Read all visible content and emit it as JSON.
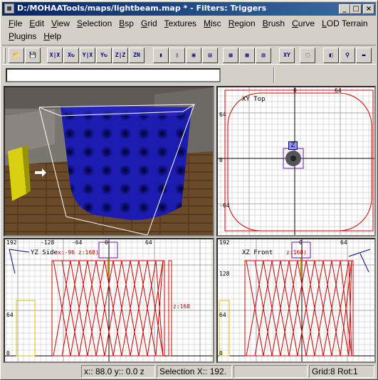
{
  "window": {
    "title": "D:/MOHAATools/maps/lightbeam.map * - Filters: Triggers",
    "minimize": "_",
    "maximize": "□",
    "close": "×"
  },
  "menu": {
    "row1": [
      "File",
      "Edit",
      "View",
      "Selection",
      "Bsp",
      "Grid",
      "Textures",
      "Misc",
      "Region",
      "Brush",
      "Curve",
      "LOD Terrain"
    ],
    "row2": [
      "Plugins",
      "Help"
    ]
  },
  "toolbar": {
    "buttons": [
      {
        "name": "open-icon",
        "glyph": "📂"
      },
      {
        "name": "save-icon",
        "glyph": "💾"
      },
      {
        "name": "flip-x-icon",
        "glyph": "X|X"
      },
      {
        "name": "rotate-x-icon",
        "glyph": "X↻"
      },
      {
        "name": "flip-y-icon",
        "glyph": "Y|X"
      },
      {
        "name": "rotate-y-icon",
        "glyph": "Y↻"
      },
      {
        "name": "flip-z-icon",
        "glyph": "Z|Z"
      },
      {
        "name": "rotate-z-icon",
        "glyph": "ZN"
      },
      {
        "name": "csg-subtract-icon",
        "glyph": "▮"
      },
      {
        "name": "csg-merge-icon",
        "glyph": "▯"
      },
      {
        "name": "hollow-icon",
        "glyph": "▣"
      },
      {
        "name": "clipper-icon",
        "glyph": "▤"
      },
      {
        "name": "select-touching-icon",
        "glyph": "▦"
      },
      {
        "name": "select-inside-icon",
        "glyph": "▩"
      },
      {
        "name": "select-partial-icon",
        "glyph": "▧"
      },
      {
        "name": "view-change-icon",
        "glyph": "XY"
      },
      {
        "name": "texture-icon",
        "glyph": "⬚"
      },
      {
        "name": "camera-icon",
        "glyph": "◧"
      },
      {
        "name": "entity-tree-icon",
        "glyph": "⚲"
      },
      {
        "name": "patch-icon",
        "glyph": "▬"
      }
    ]
  },
  "viewports": {
    "top": {
      "label": "XY Top",
      "ticks_x": [
        "0",
        "64"
      ],
      "ticks_y": [
        "64",
        "0",
        "-64"
      ],
      "marker": "Z"
    },
    "side": {
      "label": "YZ Side",
      "ticks_x": [
        "-128",
        "-64",
        "0",
        "64"
      ],
      "ticks_y": [
        "192",
        "64",
        "0"
      ],
      "coord_label": "x:-96  z:168)",
      "height_label": "z:168"
    },
    "front": {
      "label": "XZ Front",
      "ticks_x": [
        "0",
        "64"
      ],
      "ticks_y": [
        "192",
        "128",
        "64",
        "0"
      ],
      "coord_label": "z:168)"
    }
  },
  "status": {
    "coords": "x:: 88.0  y:: 0.0  z",
    "selection": "Selection X:: 192.",
    "grid": "Grid:8 Rot:1"
  }
}
